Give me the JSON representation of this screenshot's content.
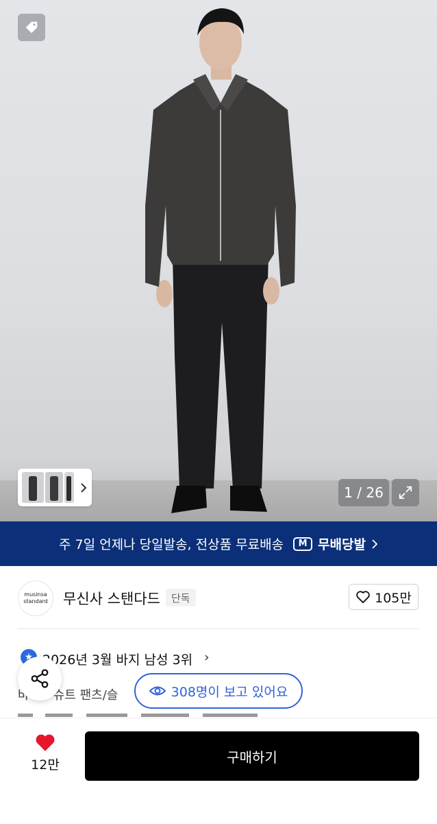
{
  "image": {
    "counter": "1 / 26",
    "tag_icon": "price-tag-icon",
    "expand_icon": "expand-icon",
    "next_icon": "chevron-right-icon"
  },
  "banner": {
    "text": "주 7일 언제나 당일발송, 전상품 무료배송",
    "badge": "M",
    "fast_label": "무배당발",
    "color": "#0b2f78"
  },
  "brand": {
    "logo_line1": "musinsa",
    "logo_line2": "standard",
    "name": "무신사 스탠다드",
    "exclusive": "단독",
    "likes": "105만"
  },
  "ranking": {
    "icon_label": "★",
    "text": "2026년 3월 바지 남성 3위",
    "chevron": "›"
  },
  "breadcrumb": "바지 › 슈트 팬츠/슬",
  "viewers": {
    "text": "308명이 보고 있어요",
    "color": "#2f63d8"
  },
  "bottom": {
    "likes": "12만",
    "buy_label": "구매하기",
    "heart_color": "#e6172c"
  }
}
